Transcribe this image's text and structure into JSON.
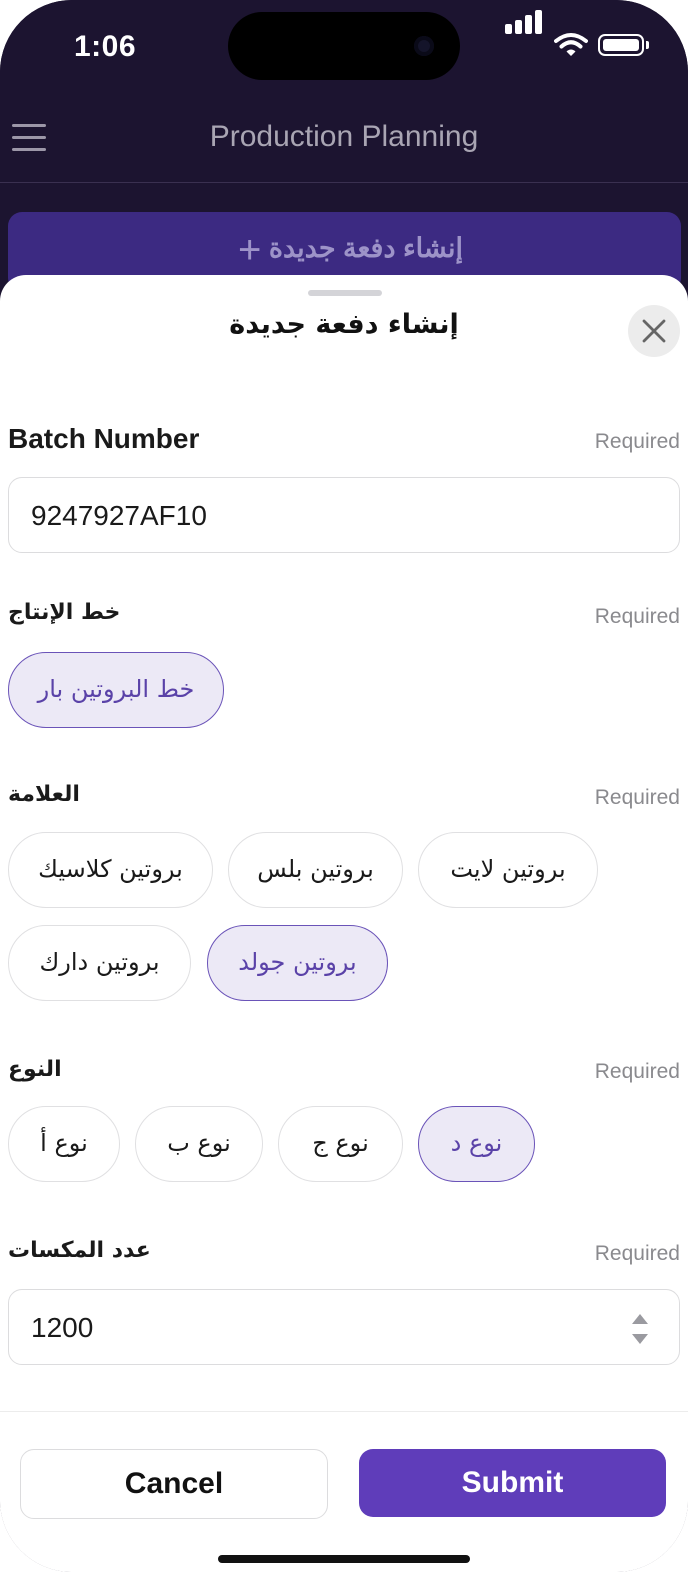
{
  "status_bar": {
    "time": "1:06"
  },
  "navbar": {
    "title": "Production Planning"
  },
  "background_action": {
    "label": "إنشاء دفعة جديدة",
    "plus": "+"
  },
  "sheet": {
    "title": "إنشاء دفعة جديدة",
    "required_text": "Required",
    "batch_number": {
      "label": "Batch Number",
      "value": "9247927AF10"
    },
    "production_line": {
      "label": "خط الإنتاج",
      "options": [
        "خط البروتين بار"
      ],
      "selected": "خط البروتين بار"
    },
    "brand": {
      "label": "العلامة",
      "options": [
        "بروتين لايت",
        "بروتين بلس",
        "بروتين كلاسيك",
        "بروتين جولد",
        "بروتين دارك"
      ],
      "selected": "بروتين جولد"
    },
    "type": {
      "label": "النوع",
      "options": [
        "نوع د",
        "نوع ج",
        "نوع ب",
        "نوع أ"
      ],
      "selected": "نوع د"
    },
    "quantity": {
      "label": "عدد المكسات",
      "value": "1200"
    }
  },
  "footer": {
    "cancel_label": "Cancel",
    "submit_label": "Submit"
  },
  "colors": {
    "accent": "#5f3dba",
    "selected_chip_bg": "#ece9f6",
    "dark_header": "#1c1430"
  }
}
